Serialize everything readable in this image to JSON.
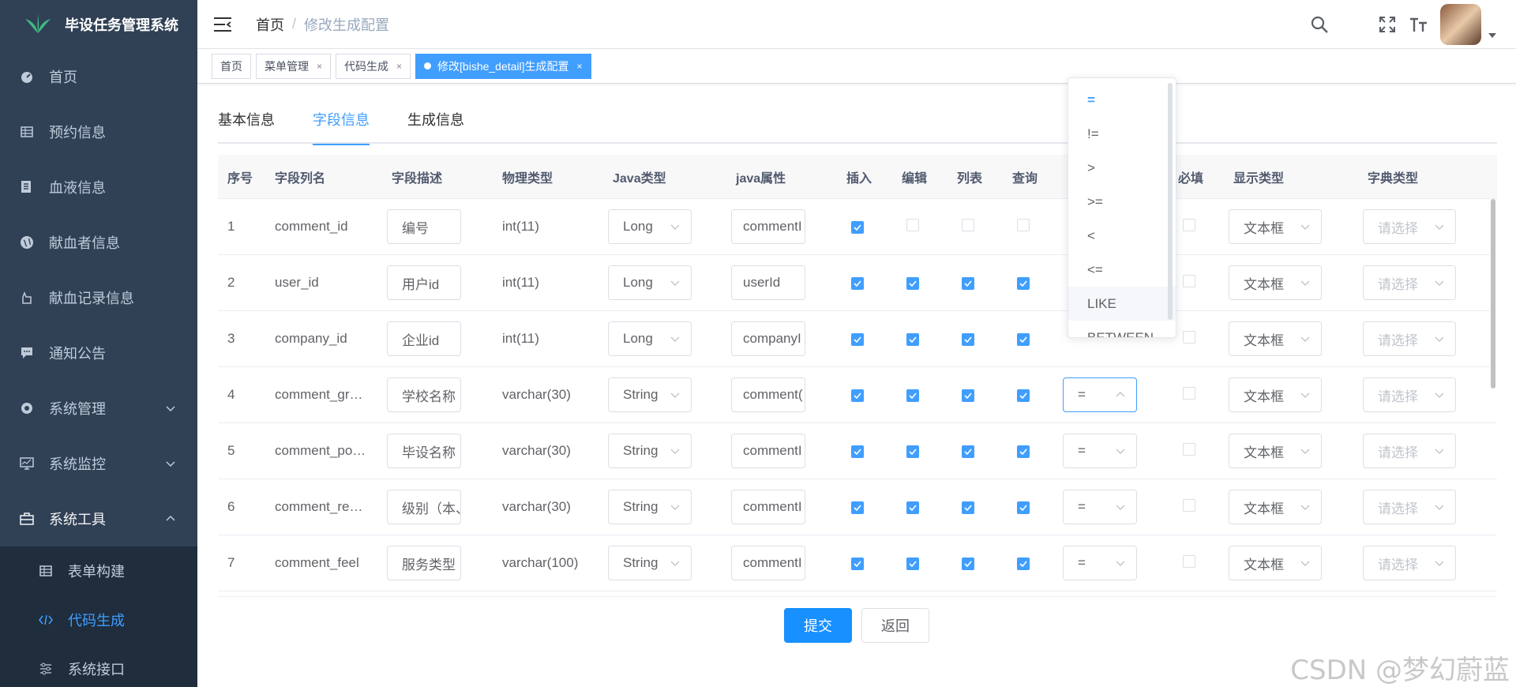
{
  "app": {
    "title": "毕设任务管理系统"
  },
  "sidebar": {
    "items": [
      {
        "label": "首页"
      },
      {
        "label": "预约信息"
      },
      {
        "label": "血液信息"
      },
      {
        "label": "献血者信息"
      },
      {
        "label": "献血记录信息"
      },
      {
        "label": "通知公告"
      },
      {
        "label": "系统管理"
      },
      {
        "label": "系统监控"
      },
      {
        "label": "系统工具"
      }
    ],
    "subitems": [
      {
        "label": "表单构建"
      },
      {
        "label": "代码生成"
      },
      {
        "label": "系统接口"
      }
    ]
  },
  "breadcrumb": {
    "home": "首页",
    "sep": "/",
    "current": "修改生成配置"
  },
  "tags": [
    {
      "label": "首页"
    },
    {
      "label": "菜单管理",
      "close": "×"
    },
    {
      "label": "代码生成",
      "close": "×"
    },
    {
      "label": "修改[bishe_detail]生成配置",
      "close": "×"
    }
  ],
  "tabs": [
    "基本信息",
    "字段信息",
    "生成信息"
  ],
  "columns": [
    "序号",
    "字段列名",
    "字段描述",
    "物理类型",
    "Java类型",
    "java属性",
    "插入",
    "编辑",
    "列表",
    "查询",
    "",
    "必填",
    "显示类型",
    "字典类型"
  ],
  "rows": [
    {
      "no": "1",
      "column": "comment_id",
      "desc": "编号",
      "type": "int(11)",
      "java_type": "Long",
      "java_field": "commentI",
      "insert": true,
      "edit": false,
      "list": false,
      "query": false,
      "query_type": "",
      "required": false,
      "html_type": "文本框",
      "dict": "请选择"
    },
    {
      "no": "2",
      "column": "user_id",
      "desc": "用户id",
      "type": "int(11)",
      "java_type": "Long",
      "java_field": "userId",
      "insert": true,
      "edit": true,
      "list": true,
      "query": true,
      "query_type": "",
      "required": false,
      "html_type": "文本框",
      "dict": "请选择"
    },
    {
      "no": "3",
      "column": "company_id",
      "desc": "企业id",
      "type": "int(11)",
      "java_type": "Long",
      "java_field": "companyI",
      "insert": true,
      "edit": true,
      "list": true,
      "query": true,
      "query_type": "",
      "required": false,
      "html_type": "文本框",
      "dict": "请选择"
    },
    {
      "no": "4",
      "column": "comment_gr…",
      "desc": "学校名称",
      "type": "varchar(30)",
      "java_type": "String",
      "java_field": "comment(",
      "insert": true,
      "edit": true,
      "list": true,
      "query": true,
      "query_type": "=",
      "required": false,
      "html_type": "文本框",
      "dict": "请选择"
    },
    {
      "no": "5",
      "column": "comment_po…",
      "desc": "毕设名称",
      "type": "varchar(30)",
      "java_type": "String",
      "java_field": "commentI",
      "insert": true,
      "edit": true,
      "list": true,
      "query": true,
      "query_type": "=",
      "required": false,
      "html_type": "文本框",
      "dict": "请选择"
    },
    {
      "no": "6",
      "column": "comment_re…",
      "desc": "级别（本、",
      "type": "varchar(30)",
      "java_type": "String",
      "java_field": "commentI",
      "insert": true,
      "edit": true,
      "list": true,
      "query": true,
      "query_type": "=",
      "required": false,
      "html_type": "文本框",
      "dict": "请选择"
    },
    {
      "no": "7",
      "column": "comment_feel",
      "desc": "服务类型",
      "type": "varchar(100)",
      "java_type": "String",
      "java_field": "commentI",
      "insert": true,
      "edit": true,
      "list": true,
      "query": true,
      "query_type": "=",
      "required": false,
      "html_type": "文本框",
      "dict": "请选择"
    }
  ],
  "dropdown": {
    "options": [
      "=",
      "!=",
      ">",
      ">=",
      "<",
      "<=",
      "LIKE",
      "BETWEEN"
    ],
    "selected": "=",
    "hovered": "LIKE"
  },
  "buttons": {
    "submit": "提交",
    "back": "返回"
  },
  "watermark": "CSDN @梦幻蔚蓝",
  "colors": {
    "primary": "#409eff",
    "sidebar": "#304156",
    "submenu": "#1f2d3d"
  }
}
